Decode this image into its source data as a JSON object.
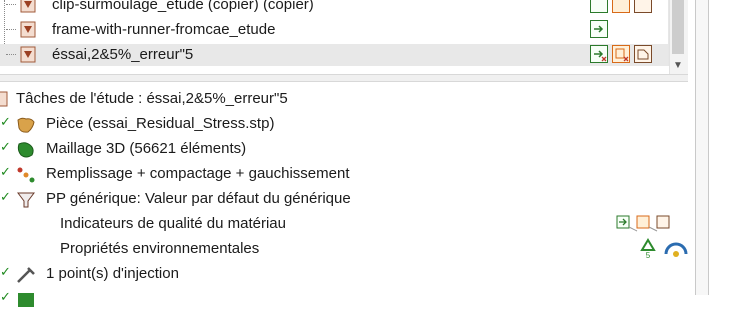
{
  "studies": [
    {
      "name": "clip-surmoulage_etude (copier) (copier)"
    },
    {
      "name": "frame-with-runner-fromcae_etude"
    },
    {
      "name": "éssai,2&5%_erreur\"5"
    }
  ],
  "tasks_header": "Tâches de l'étude : éssai,2&5%_erreur\"5",
  "tasks": [
    {
      "label": "Pièce (essai_Residual_Stress.stp)",
      "icon": "part-icon"
    },
    {
      "label": "Maillage 3D (56621 éléments)",
      "icon": "mesh-icon"
    },
    {
      "label": "Remplissage + compactage + gauchissement",
      "icon": "analysis-sequence-icon"
    },
    {
      "label": "PP générique: Valeur par défaut du générique",
      "icon": "material-icon"
    },
    {
      "label": "Indicateurs de qualité du matériau",
      "icon": ""
    },
    {
      "label": "Propriétés environnementales",
      "icon": ""
    },
    {
      "label": "1 point(s) d'injection",
      "icon": "injection-point-icon"
    }
  ],
  "colors": {
    "selected_row_bg": "#e8e8e8",
    "check_green": "#1f8a1f",
    "action_orange": "#d86a18",
    "action_green": "#2b7a2b"
  }
}
